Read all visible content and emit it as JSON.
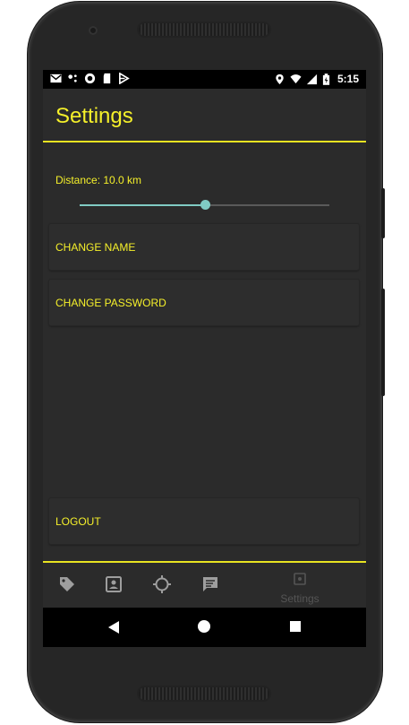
{
  "status_bar": {
    "time": "5:15",
    "left_icons": [
      "gmail-icon",
      "maps-dots-icon",
      "record-icon",
      "sd-card-icon",
      "play-store-icon"
    ],
    "right_icons": [
      "location-icon",
      "wifi-icon",
      "signal-icon",
      "battery-icon"
    ]
  },
  "app_bar": {
    "title": "Settings"
  },
  "distance": {
    "label": "Distance: 10.0 km",
    "slider_fraction": 0.5
  },
  "buttons": {
    "change_name": "CHANGE NAME",
    "change_password": "CHANGE PASSWORD",
    "logout": "LOGOUT"
  },
  "bottom_nav": {
    "items": [
      {
        "icon": "tag-icon"
      },
      {
        "icon": "contact-card-icon"
      },
      {
        "icon": "crosshair-icon"
      },
      {
        "icon": "chat-icon"
      }
    ],
    "settings_label": "Settings"
  },
  "colors": {
    "accent": "#f5f02a",
    "slider": "#80cbc4",
    "background": "#2b2b2b"
  }
}
